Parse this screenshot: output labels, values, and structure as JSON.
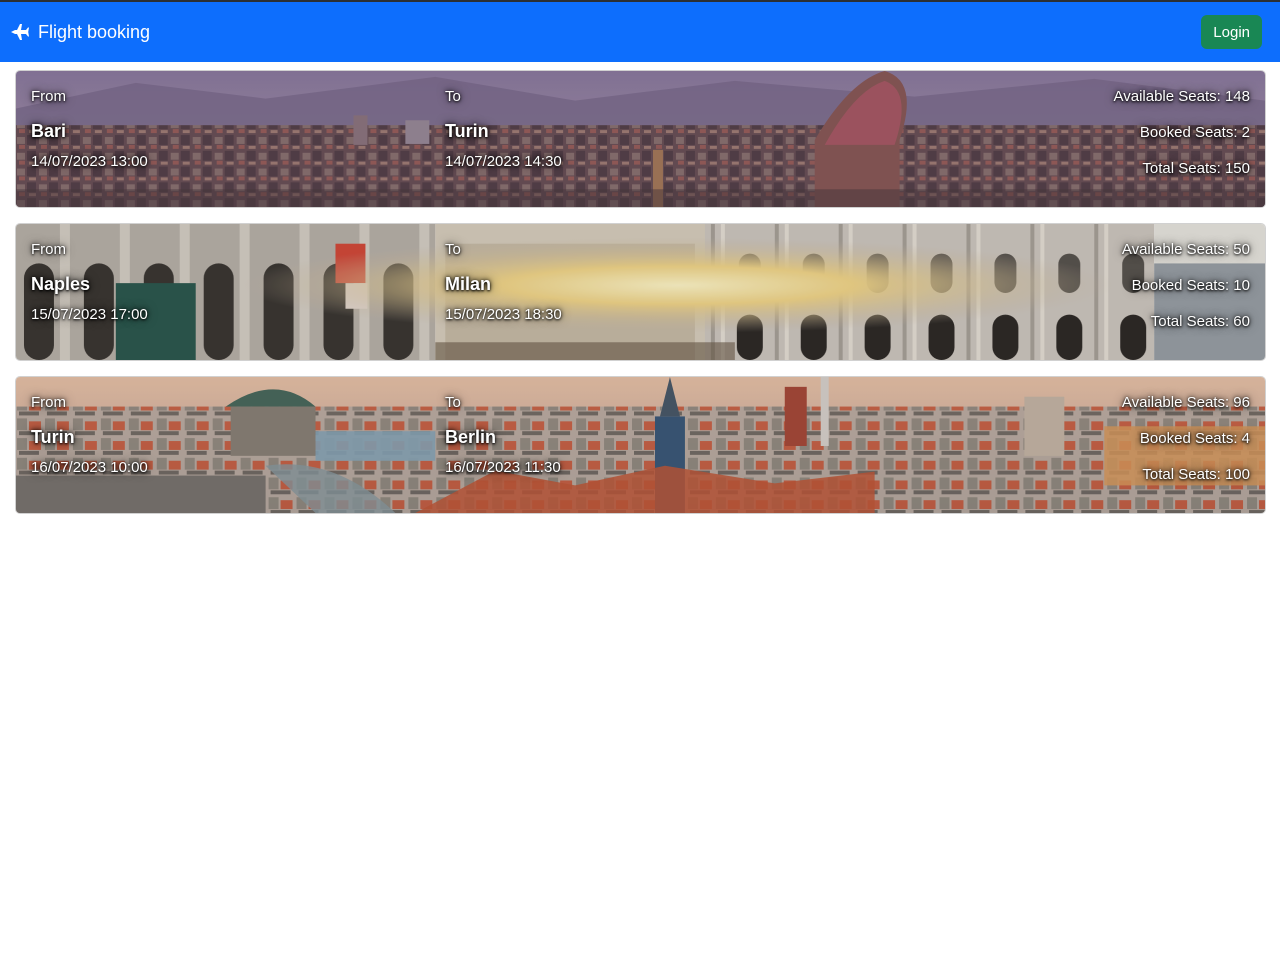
{
  "navbar": {
    "brand_icon": "airplane-icon",
    "brand_title": "Flight booking",
    "login_label": "Login",
    "accent_color": "#0d6efd",
    "login_color": "#198754"
  },
  "flights": [
    {
      "from_label": "From",
      "from_city": "Bari",
      "departure": "14/07/2023 13:00",
      "to_label": "To",
      "to_city": "Turin",
      "arrival": "14/07/2023 14:30",
      "available_seats": "Available Seats: 148",
      "booked_seats": "Booked Seats: 2",
      "total_seats": "Total Seats: 150",
      "background": "turin-skyline-image"
    },
    {
      "from_label": "From",
      "from_city": "Naples",
      "departure": "15/07/2023 17:00",
      "to_label": "To",
      "to_city": "Milan",
      "arrival": "15/07/2023 18:30",
      "available_seats": "Available Seats: 50",
      "booked_seats": "Booked Seats: 10",
      "total_seats": "Total Seats: 60",
      "background": "milan-cathedral-image"
    },
    {
      "from_label": "From",
      "from_city": "Turin",
      "departure": "16/07/2023 10:00",
      "to_label": "To",
      "to_city": "Berlin",
      "arrival": "16/07/2023 11:30",
      "available_seats": "Available Seats: 96",
      "booked_seats": "Booked Seats: 4",
      "total_seats": "Total Seats: 100",
      "background": "berlin-skyline-image"
    }
  ]
}
